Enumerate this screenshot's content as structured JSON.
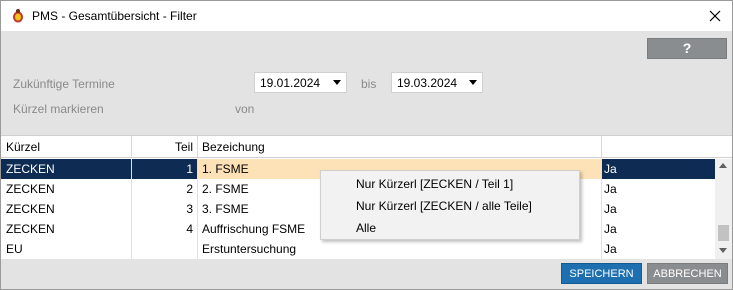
{
  "window": {
    "title": "PMS - Gesamtübersicht - Filter"
  },
  "toolbar": {
    "help_label": "?"
  },
  "filter": {
    "zukuenftige_label": "Zukünftige Termine",
    "from_date": "19.01.2024",
    "bis_label": "bis",
    "to_date": "19.03.2024",
    "kuerzel_label": "Kürzel markieren",
    "von_label": "von"
  },
  "table": {
    "headers": [
      "Kürzel",
      "Teil",
      "Bezeichung",
      ""
    ],
    "rows": [
      {
        "kuerzel": "ZECKEN",
        "teil": "1",
        "bezeichnung": "1. FSME",
        "ja": "Ja",
        "selected": true
      },
      {
        "kuerzel": "ZECKEN",
        "teil": "2",
        "bezeichnung": "2. FSME",
        "ja": "Ja",
        "selected": false
      },
      {
        "kuerzel": "ZECKEN",
        "teil": "3",
        "bezeichnung": "3. FSME",
        "ja": "Ja",
        "selected": false
      },
      {
        "kuerzel": "ZECKEN",
        "teil": "4",
        "bezeichnung": "Auffrischung FSME",
        "ja": "Ja",
        "selected": false
      },
      {
        "kuerzel": "EU",
        "teil": "",
        "bezeichnung": "Erstuntersuchung",
        "ja": "Ja",
        "selected": false
      }
    ]
  },
  "context_menu": {
    "items": [
      "Nur Kürzerl [ZECKEN / Teil 1]",
      "Nur Kürzerl [ZECKEN / alle Teile]",
      "Alle"
    ]
  },
  "buttons": {
    "save_label": "SPEICHERN",
    "cancel_label": "ABBRECHEN"
  },
  "colors": {
    "selection_dark": "#0d2b53",
    "selection_highlight": "#fde2b7",
    "primary_button": "#1d6faf",
    "secondary_button": "#8a8d8f"
  }
}
